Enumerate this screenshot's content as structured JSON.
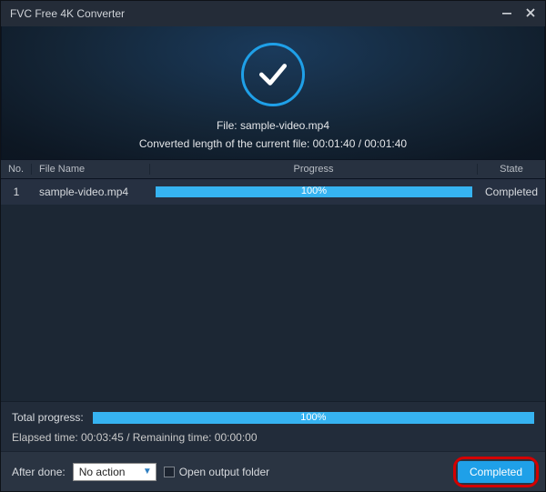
{
  "titlebar": {
    "title": "FVC Free 4K Converter"
  },
  "status": {
    "file_prefix": "File: ",
    "file_name": "sample-video.mp4",
    "converted_line": "Converted length of the current file: 00:01:40 / 00:01:40"
  },
  "table": {
    "headers": {
      "no": "No.",
      "file": "File Name",
      "progress": "Progress",
      "state": "State"
    },
    "rows": [
      {
        "no": "1",
        "file": "sample-video.mp4",
        "progress_pct": "100%",
        "state": "Completed"
      }
    ]
  },
  "footer": {
    "total_label": "Total progress:",
    "total_pct": "100%",
    "elapsed_line": "Elapsed time: 00:03:45 / Remaining time: 00:00:00",
    "after_done_label": "After done:",
    "after_done_value": "No action",
    "open_folder_label": "Open output folder",
    "completed_button": "Completed"
  }
}
